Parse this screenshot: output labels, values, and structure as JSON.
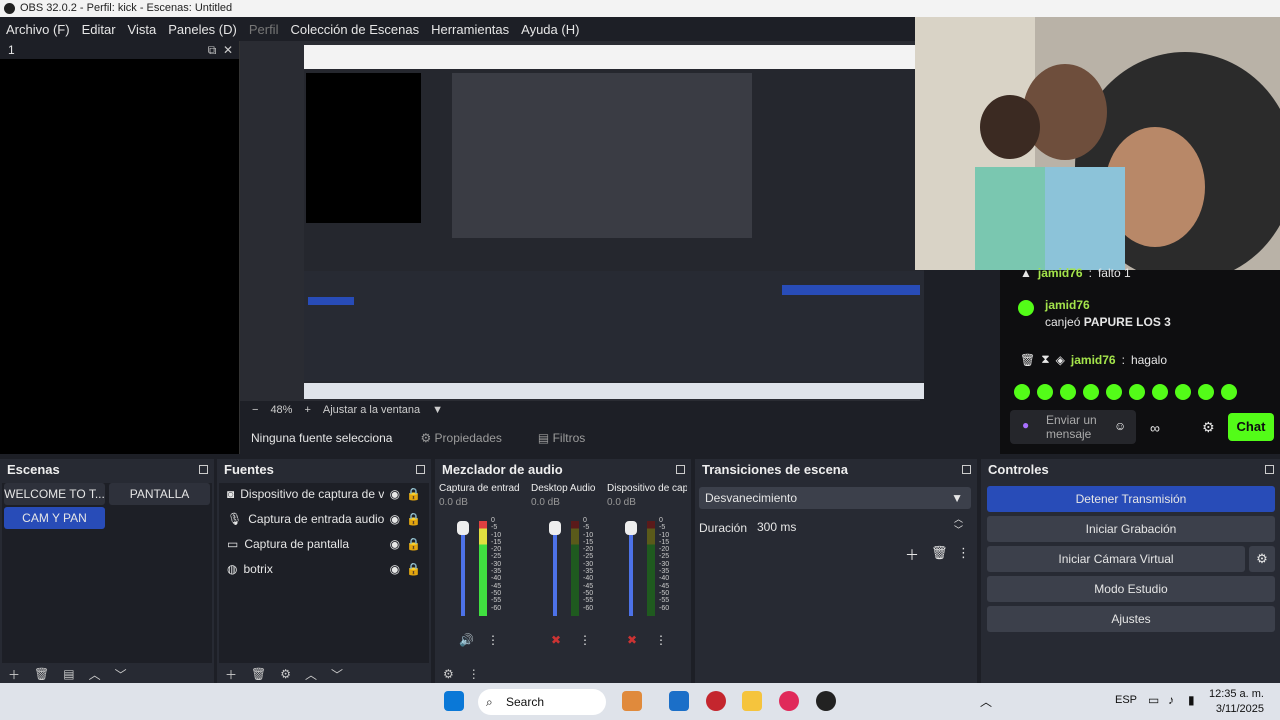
{
  "window": {
    "title": "OBS 32.0.2 - Perfil: kick - Escenas: Untitled"
  },
  "menu": [
    "Archivo (F)",
    "Editar",
    "Vista",
    "Paneles (D)",
    "Perfil",
    "Colección de Escenas",
    "Herramientas",
    "Ayuda (H)"
  ],
  "left_dock": {
    "title": "1"
  },
  "zoom": {
    "minus": "−",
    "value": "48%",
    "plus": "+",
    "fit": "Ajustar a la ventana"
  },
  "context": {
    "no_source": "Ninguna fuente selecciona",
    "properties": "Propiedades",
    "filters": "Filtros"
  },
  "chat": {
    "line0": {
      "user": "jamid76",
      "text": "falto 1"
    },
    "line1": {
      "user": "jamid76",
      "text": "canjeó",
      "reward": "PAPURE LOS 3"
    },
    "line2": {
      "user": "jamid76",
      "text": "hagalo"
    },
    "input_placeholder": "Enviar un mensaje",
    "chat_button": "Chat"
  },
  "scenes": {
    "title": "Escenas",
    "items": [
      "WELCOME TO T...",
      "PANTALLA",
      "CAM Y PAN"
    ]
  },
  "sources": {
    "title": "Fuentes",
    "items": [
      {
        "label": "Dispositivo de captura de v",
        "icon": "camera-icon"
      },
      {
        "label": "Captura de entrada audio",
        "icon": "microphone-icon"
      },
      {
        "label": "Captura de pantalla",
        "icon": "monitor-icon"
      },
      {
        "label": "botrix",
        "icon": "globe-icon"
      }
    ]
  },
  "mixer": {
    "title": "Mezclador de audio",
    "channels": [
      {
        "name": "Captura de entrada",
        "db": "0.0 dB",
        "level": 0.75
      },
      {
        "name": "Desktop Audio",
        "db": "0.0 dB",
        "level": 0.0
      },
      {
        "name": "Dispositivo de capt",
        "db": "0.0 dB",
        "level": 0.0
      }
    ],
    "ticks": [
      "0",
      "-5",
      "-10",
      "-15",
      "-20",
      "-25",
      "-30",
      "-35",
      "-40",
      "-45",
      "-50",
      "-55",
      "-60"
    ]
  },
  "transitions": {
    "title": "Transiciones de escena",
    "selected": "Desvanecimiento",
    "duration_label": "Duración",
    "duration_value": "300 ms"
  },
  "controls": {
    "title": "Controles",
    "buttons": [
      "Detener Transmisión",
      "Iniciar Grabación",
      "Iniciar Cámara Virtual",
      "Modo Estudio",
      "Ajustes"
    ]
  },
  "taskbar": {
    "search": "Search",
    "lang": "ESP",
    "time": "12:35 a. m.",
    "date": "3/11/2025"
  },
  "colors": {
    "accent": "#284cb8",
    "kick_green": "#53fc18"
  }
}
